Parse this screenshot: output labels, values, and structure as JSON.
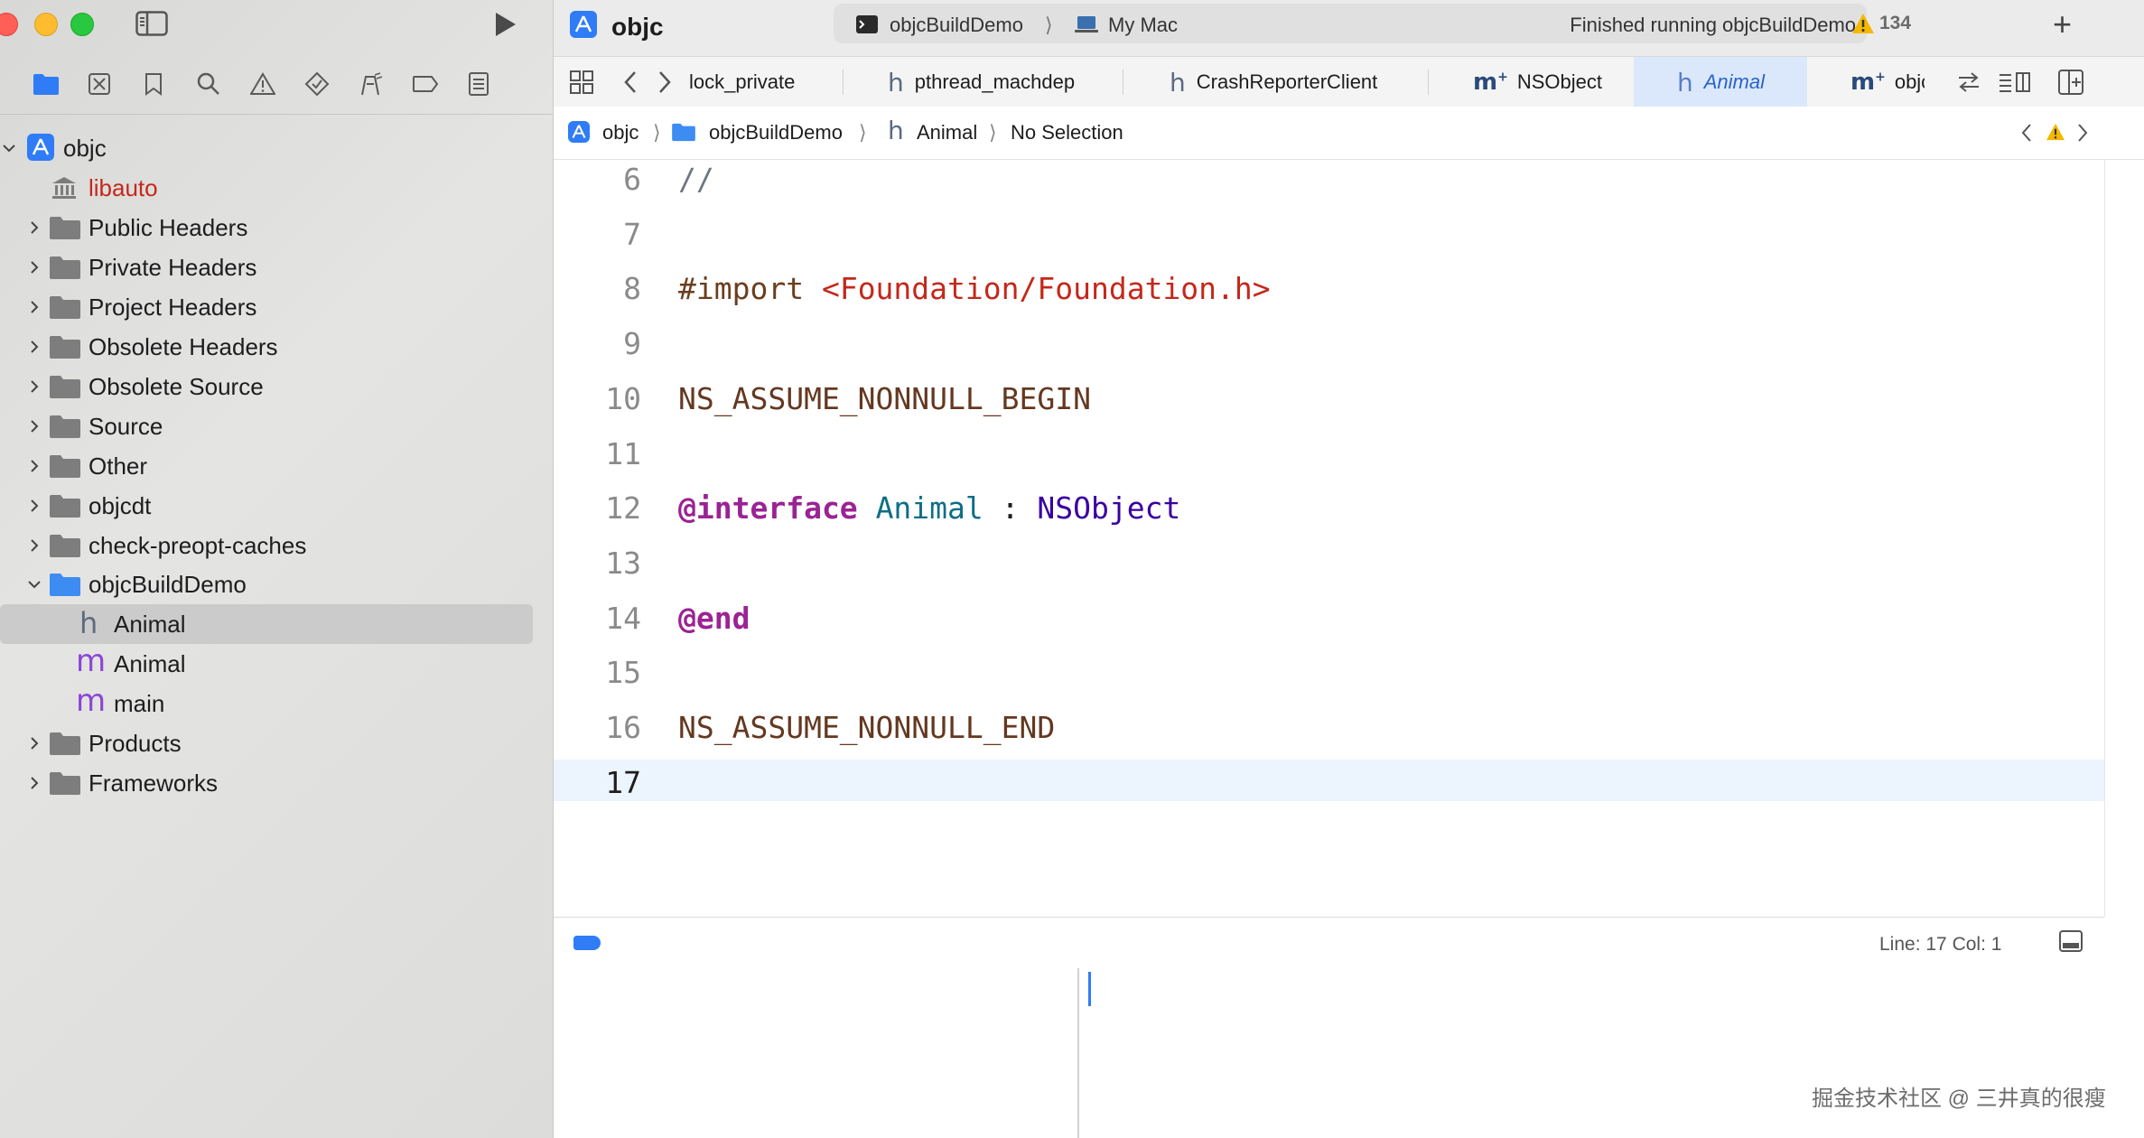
{
  "toolbar": {
    "project_title": "objc",
    "scheme": "objcBuildDemo",
    "destination": "My Mac",
    "status": "Finished running objcBuildDemo",
    "warnings_count": "134",
    "add_label": "+"
  },
  "tabs": [
    {
      "label": "lock_private",
      "kind": "none"
    },
    {
      "label": "pthread_machdep",
      "kind": "h"
    },
    {
      "label": "CrashReporterClient",
      "kind": "h"
    },
    {
      "label": "NSObject",
      "kind": "m+"
    },
    {
      "label": "Animal",
      "kind": "h",
      "active": true
    },
    {
      "label": "objc-o",
      "kind": "m+"
    }
  ],
  "tab_glyphs": {
    "h": "h",
    "m_plus": "m"
  },
  "jumpbar": {
    "items": [
      "objc",
      "objcBuildDemo",
      "Animal",
      "No Selection"
    ],
    "sep": "⟩"
  },
  "navigator": {
    "root": "objc",
    "items": [
      {
        "label": "libauto",
        "type": "library",
        "color": "#c4281b"
      },
      {
        "label": "Public Headers",
        "type": "folder"
      },
      {
        "label": "Private Headers",
        "type": "folder"
      },
      {
        "label": "Project Headers",
        "type": "folder"
      },
      {
        "label": "Obsolete Headers",
        "type": "folder"
      },
      {
        "label": "Obsolete Source",
        "type": "folder"
      },
      {
        "label": "Source",
        "type": "folder"
      },
      {
        "label": "Other",
        "type": "folder"
      },
      {
        "label": "objcdt",
        "type": "folder"
      },
      {
        "label": "check-preopt-caches",
        "type": "folder"
      },
      {
        "label": "objcBuildDemo",
        "type": "folder-open"
      },
      {
        "label": "Animal",
        "type": "h-file",
        "selected": true
      },
      {
        "label": "Animal",
        "type": "m-file"
      },
      {
        "label": "main",
        "type": "m-file"
      },
      {
        "label": "Products",
        "type": "folder"
      },
      {
        "label": "Frameworks",
        "type": "folder"
      }
    ]
  },
  "editor": {
    "lines": [
      {
        "n": "6",
        "code": "//"
      },
      {
        "n": "7",
        "code": ""
      },
      {
        "n": "8",
        "pre": "#import",
        "str": "<Foundation/Foundation.h>"
      },
      {
        "n": "9",
        "code": ""
      },
      {
        "n": "10",
        "macro": "NS_ASSUME_NONNULL_BEGIN"
      },
      {
        "n": "11",
        "code": ""
      },
      {
        "n": "12",
        "kw": "@interface",
        "cls": "Animal",
        "colon": ":",
        "type": "NSObject"
      },
      {
        "n": "13",
        "code": ""
      },
      {
        "n": "14",
        "kw": "@end"
      },
      {
        "n": "15",
        "code": ""
      },
      {
        "n": "16",
        "macro": "NS_ASSUME_NONNULL_END"
      },
      {
        "n": "17",
        "code": "",
        "current": true
      }
    ]
  },
  "statusbar": {
    "position": "Line: 17  Col: 1"
  },
  "watermark": "掘金技术社区 @ 三井真的很瘦",
  "colors": {
    "accent": "#2f7cf6",
    "keyword": "#9b2393",
    "string": "#c4281b",
    "class": "#0f6e85",
    "type": "#3900a0",
    "macro": "#643820"
  }
}
